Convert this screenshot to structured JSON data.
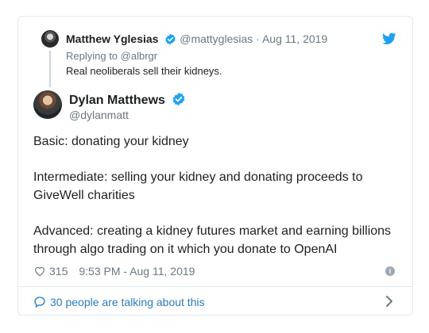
{
  "parent_tweet": {
    "author_name": "Matthew Yglesias",
    "handle": "@mattyglesias",
    "separator": "·",
    "date": "Aug 11, 2019",
    "replying_to": "Replying to @albrgr",
    "text": "Real neoliberals sell their kidneys."
  },
  "tweet": {
    "author_name": "Dylan Matthews",
    "handle": "@dylanmatt",
    "paragraphs": [
      "Basic: donating your kidney",
      "Intermediate: selling your kidney and donating proceeds to GiveWell charities",
      "Advanced: creating a kidney futures market and earning billions through algo trading on it which you donate to OpenAI"
    ],
    "likes": "315",
    "timestamp": "9:53 PM - Aug 11, 2019"
  },
  "footer": {
    "talking_label": "30 people are talking about this"
  },
  "colors": {
    "verified": "#1da1f2",
    "link": "#2b7bb9",
    "muted": "#697882",
    "border": "#e1e8ed"
  },
  "icons": [
    "twitter-bird-icon",
    "verified-badge-icon",
    "heart-icon",
    "info-icon",
    "chat-bubble-icon",
    "chevron-right-icon"
  ]
}
